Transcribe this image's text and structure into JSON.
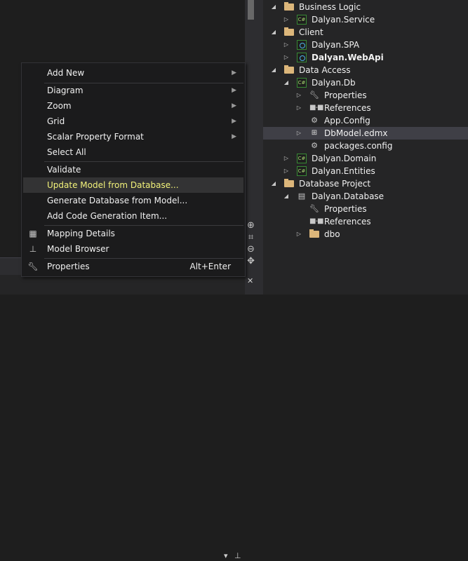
{
  "context_menu": {
    "items": [
      {
        "label": "Add New",
        "submenu": true
      },
      {
        "label": "Diagram",
        "submenu": true
      },
      {
        "label": "Zoom",
        "submenu": true
      },
      {
        "label": "Grid",
        "submenu": true
      },
      {
        "label": "Scalar Property Format",
        "submenu": true
      },
      {
        "label": "Select All"
      },
      {
        "label": "Validate"
      },
      {
        "label": "Update Model from Database...",
        "highlighted": true
      },
      {
        "label": "Generate Database from Model..."
      },
      {
        "label": "Add Code Generation Item..."
      },
      {
        "label": "Mapping Details",
        "icon": "mapping-details-icon"
      },
      {
        "label": "Model Browser",
        "icon": "model-browser-icon"
      },
      {
        "label": "Properties",
        "icon": "wrench-icon",
        "shortcut": "Alt+Enter"
      }
    ]
  },
  "solution_explorer": {
    "nodes": [
      {
        "label": "Business Logic",
        "icon": "solution-folder-icon",
        "state": "expanded"
      },
      {
        "label": "Dalyan.Service",
        "icon": "csharp-project-icon",
        "state": "collapsed"
      },
      {
        "label": "Client",
        "icon": "solution-folder-icon",
        "state": "expanded"
      },
      {
        "label": "Dalyan.SPA",
        "icon": "web-project-icon",
        "state": "collapsed"
      },
      {
        "label": "Dalyan.WebApi",
        "icon": "web-project-icon",
        "state": "collapsed",
        "bold": true
      },
      {
        "label": "Data Access",
        "icon": "solution-folder-icon",
        "state": "expanded"
      },
      {
        "label": "Dalyan.Db",
        "icon": "csharp-project-icon",
        "state": "expanded"
      },
      {
        "label": "Properties",
        "icon": "wrench-icon",
        "state": "collapsed"
      },
      {
        "label": "References",
        "icon": "references-icon",
        "state": "collapsed"
      },
      {
        "label": "App.Config",
        "icon": "config-file-icon"
      },
      {
        "label": "DbModel.edmx",
        "icon": "edmx-file-icon",
        "state": "collapsed",
        "selected": true
      },
      {
        "label": "packages.config",
        "icon": "config-file-icon"
      },
      {
        "label": "Dalyan.Domain",
        "icon": "csharp-project-icon",
        "state": "collapsed"
      },
      {
        "label": "Dalyan.Entities",
        "icon": "csharp-project-icon",
        "state": "collapsed"
      },
      {
        "label": "Database Project",
        "icon": "solution-folder-icon",
        "state": "expanded"
      },
      {
        "label": "Dalyan.Database",
        "icon": "database-project-icon",
        "state": "expanded"
      },
      {
        "label": "Properties",
        "icon": "wrench-icon"
      },
      {
        "label": "References",
        "icon": "references-icon"
      },
      {
        "label": "dbo",
        "icon": "folder-icon",
        "state": "collapsed"
      }
    ]
  },
  "icons": {
    "csharp": "C#"
  },
  "colors": {
    "highlight_text": "#f2f27a",
    "selection_bg": "#3f3f46",
    "folder": "#dcb67a",
    "project_green": "#388a34"
  }
}
